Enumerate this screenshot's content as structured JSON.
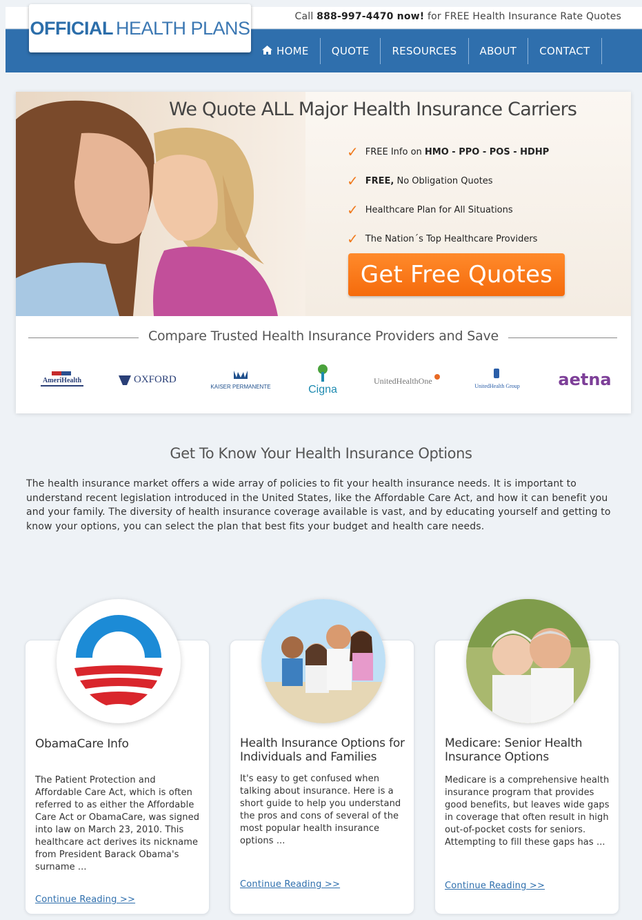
{
  "header": {
    "logo_strong": "OFFICIAL",
    "logo_light": "HEALTH PLANS",
    "call_prefix": "Call ",
    "call_number": "888-997-4470 now!",
    "call_suffix": " for FREE Health Insurance Rate Quotes"
  },
  "nav": {
    "items": [
      {
        "label": "HOME",
        "icon": "home-icon"
      },
      {
        "label": "QUOTE"
      },
      {
        "label": "RESOURCES"
      },
      {
        "label": "ABOUT"
      },
      {
        "label": "CONTACT"
      }
    ]
  },
  "hero": {
    "title": "We Quote ALL Major Health Insurance Carriers",
    "bullets": [
      {
        "prefix": "FREE Info on ",
        "strong": "HMO - PPO - POS - HDHP",
        "suffix": ""
      },
      {
        "prefix": "",
        "strong": "FREE,",
        "suffix": " No Obligation Quotes"
      },
      {
        "prefix": "Healthcare Plan for All Situations",
        "strong": "",
        "suffix": ""
      },
      {
        "prefix": "The Nation´s Top Healthcare Providers",
        "strong": "",
        "suffix": ""
      }
    ],
    "cta_label": "Get Free Quotes"
  },
  "compare": {
    "title": "Compare Trusted Health Insurance Providers and Save",
    "carriers": [
      "AmeriHealth",
      "OXFORD",
      "KAISER PERMANENTE",
      "Cigna",
      "UnitedHealthOne",
      "UnitedHealth Group",
      "aetna"
    ]
  },
  "options": {
    "title": "Get To Know Your Health Insurance Options",
    "text": "The health insurance market offers a wide array of policies to fit your health insurance needs. It is important to understand recent legislation introduced in the United States, like the Affordable Care Act, and how it can benefit you and your family. The diversity of health insurance coverage available is vast, and by educating yourself and getting to know your options, you can select the plan that best fits your budget and health care needs."
  },
  "cards": [
    {
      "title": "ObamaCare Info",
      "body": "The Patient Protection and Affordable Care Act, which is often referred to as either the Affordable Care Act or ObamaCare, was signed into law on March 23, 2010. This healthcare act derives its nickname from President Barack Obama's surname ...",
      "link": "Continue Reading >>"
    },
    {
      "title": "Health Insurance Options for Individuals and Families",
      "body": "It's easy to get confused when talking about insurance. Here is a short guide to help you understand the pros and cons of several of the most popular health insurance options ...",
      "link": "Continue Reading >>"
    },
    {
      "title": "Medicare: Senior Health Insurance Options",
      "body": "Medicare is a comprehensive health insurance program that provides good benefits, but leaves wide gaps in coverage that often result in high out-of-pocket costs for seniors. Attempting to fill these gaps has ...",
      "link": "Continue Reading >>"
    }
  ],
  "colors": {
    "brand_blue": "#2f6fad",
    "cta_orange": "#f56b0c",
    "check_orange": "#f07a1d"
  }
}
